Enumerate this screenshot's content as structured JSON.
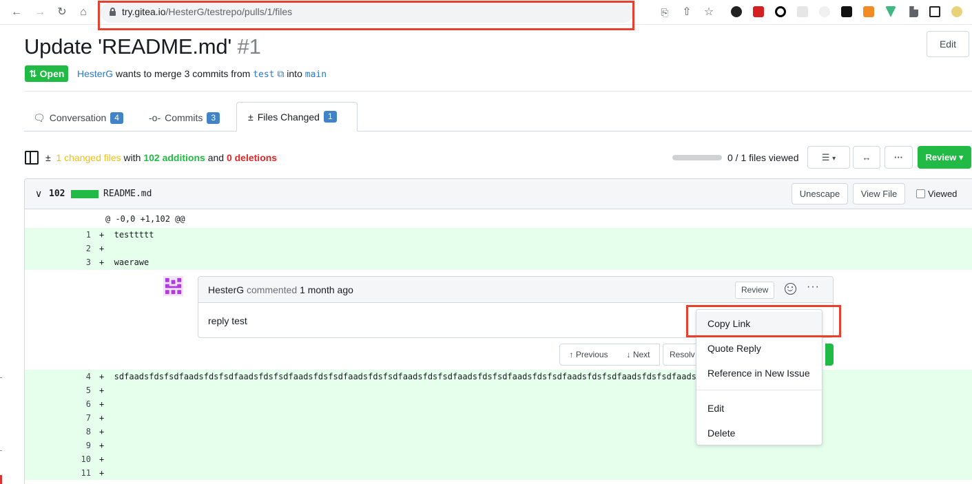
{
  "browser": {
    "url_host": "try.gitea.io",
    "url_path": "/HesterG/testrepo/pulls/1/files",
    "back_icon": "←",
    "forward_icon": "→",
    "reload_icon": "↻",
    "home_icon": "⌂",
    "translate_icon": "⎘",
    "share_icon": "⇧",
    "star_icon": "☆"
  },
  "pr": {
    "title": "Update 'README.md'",
    "number": "#1",
    "edit_label": "Edit",
    "status": "Open",
    "author": "HesterG",
    "merge_text_1": " wants to merge 3 commits from ",
    "head_branch": "test",
    "merge_text_2": " into ",
    "base_branch": "main"
  },
  "tabs": [
    {
      "label": "Conversation",
      "count": "4"
    },
    {
      "label": "Commits",
      "count": "3"
    },
    {
      "label": "Files Changed",
      "count": "1"
    }
  ],
  "diff_stats": {
    "changed": "1 changed files",
    "with": " with ",
    "additions": "102 additions",
    "and": " and ",
    "deletions": "0 deletions",
    "progress_viewed": 0,
    "viewed_text": "0 / 1 files viewed",
    "review_label": "Review ▾"
  },
  "file": {
    "count": "102",
    "name": "README.md",
    "unescape_label": "Unescape",
    "view_file_label": "View File",
    "viewed_label": "Viewed",
    "hunk": "@ -0,0 +1,102 @@"
  },
  "lines_top": [
    {
      "num": "1",
      "code": "+  testtttt"
    },
    {
      "num": "2",
      "code": "+"
    },
    {
      "num": "3",
      "code": "+  waerawe"
    }
  ],
  "lines_bottom": [
    {
      "num": "4",
      "code": "+  sdfaadsfdsfsdfaadsfdsfsdfaadsfdsfsdfaadsfdsfsdfaadsfdsfsdfaadsfdsfsdfaadsfdsfsdfaadsfdsfsdfaadsfdsfsdfaadsfdsfsdfaads"
    },
    {
      "num": "5",
      "code": "+"
    },
    {
      "num": "6",
      "code": "+"
    },
    {
      "num": "7",
      "code": "+"
    },
    {
      "num": "8",
      "code": "+"
    },
    {
      "num": "9",
      "code": "+"
    },
    {
      "num": "10",
      "code": "+"
    },
    {
      "num": "11",
      "code": "+"
    }
  ],
  "comment": {
    "author": "HesterG",
    "meta": " commented ",
    "time": "1 month ago",
    "review_label": "Review",
    "body": "reply test",
    "prev_label": "↑ Previous",
    "next_label": "↓ Next",
    "resolve_label": "Resolv"
  },
  "menu": {
    "copy_link": "Copy Link",
    "quote_reply": "Quote Reply",
    "reference": "Reference in New Issue",
    "edit": "Edit",
    "delete": "Delete"
  }
}
